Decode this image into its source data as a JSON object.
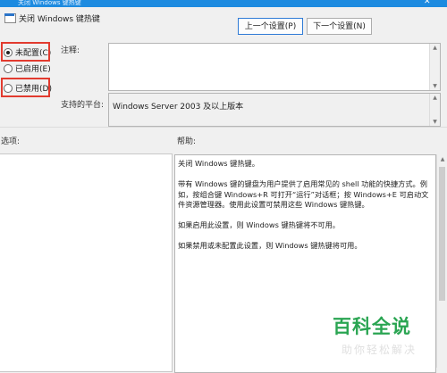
{
  "window": {
    "title": "关闭 Windows 键热键",
    "close_glyph": "✕"
  },
  "header": {
    "policy_name": "关闭 Windows 键热键",
    "prev_button": "上一个设置(P)",
    "next_button": "下一个设置(N)"
  },
  "state": {
    "options": [
      {
        "label": "未配置(C)",
        "selected": true
      },
      {
        "label": "已启用(E)",
        "selected": false
      },
      {
        "label": "已禁用(D)",
        "selected": false
      }
    ]
  },
  "comment": {
    "label": "注释:",
    "value": ""
  },
  "platform": {
    "label": "支持的平台:",
    "value": "Windows Server 2003 及以上版本"
  },
  "options_section": {
    "label": "选项:"
  },
  "help": {
    "label": "帮助:",
    "paragraphs": [
      "关闭 Windows 键热键。",
      "带有 Windows 键的键盘为用户提供了启用常见的 shell 功能的快捷方式。例如，按组合键 Windows+R 可打开“运行”对话框；按 Windows+E 可启动文件资源管理器。使用此设置可禁用这些 Windows 键热键。",
      "如果启用此设置，则 Windows 键热键将不可用。",
      "如果禁用或未配置此设置，则 Windows 键热键将可用。"
    ]
  },
  "watermark": {
    "brand": "百科全说",
    "slogan": "助你轻松解决"
  },
  "icons": [
    "policy-icon",
    "close-icon",
    "scroll-up-icon",
    "scroll-down-icon"
  ],
  "colors": {
    "titlebar": "#1d8be0",
    "highlight": "#e23b2f",
    "watermark": "#2aa552"
  }
}
